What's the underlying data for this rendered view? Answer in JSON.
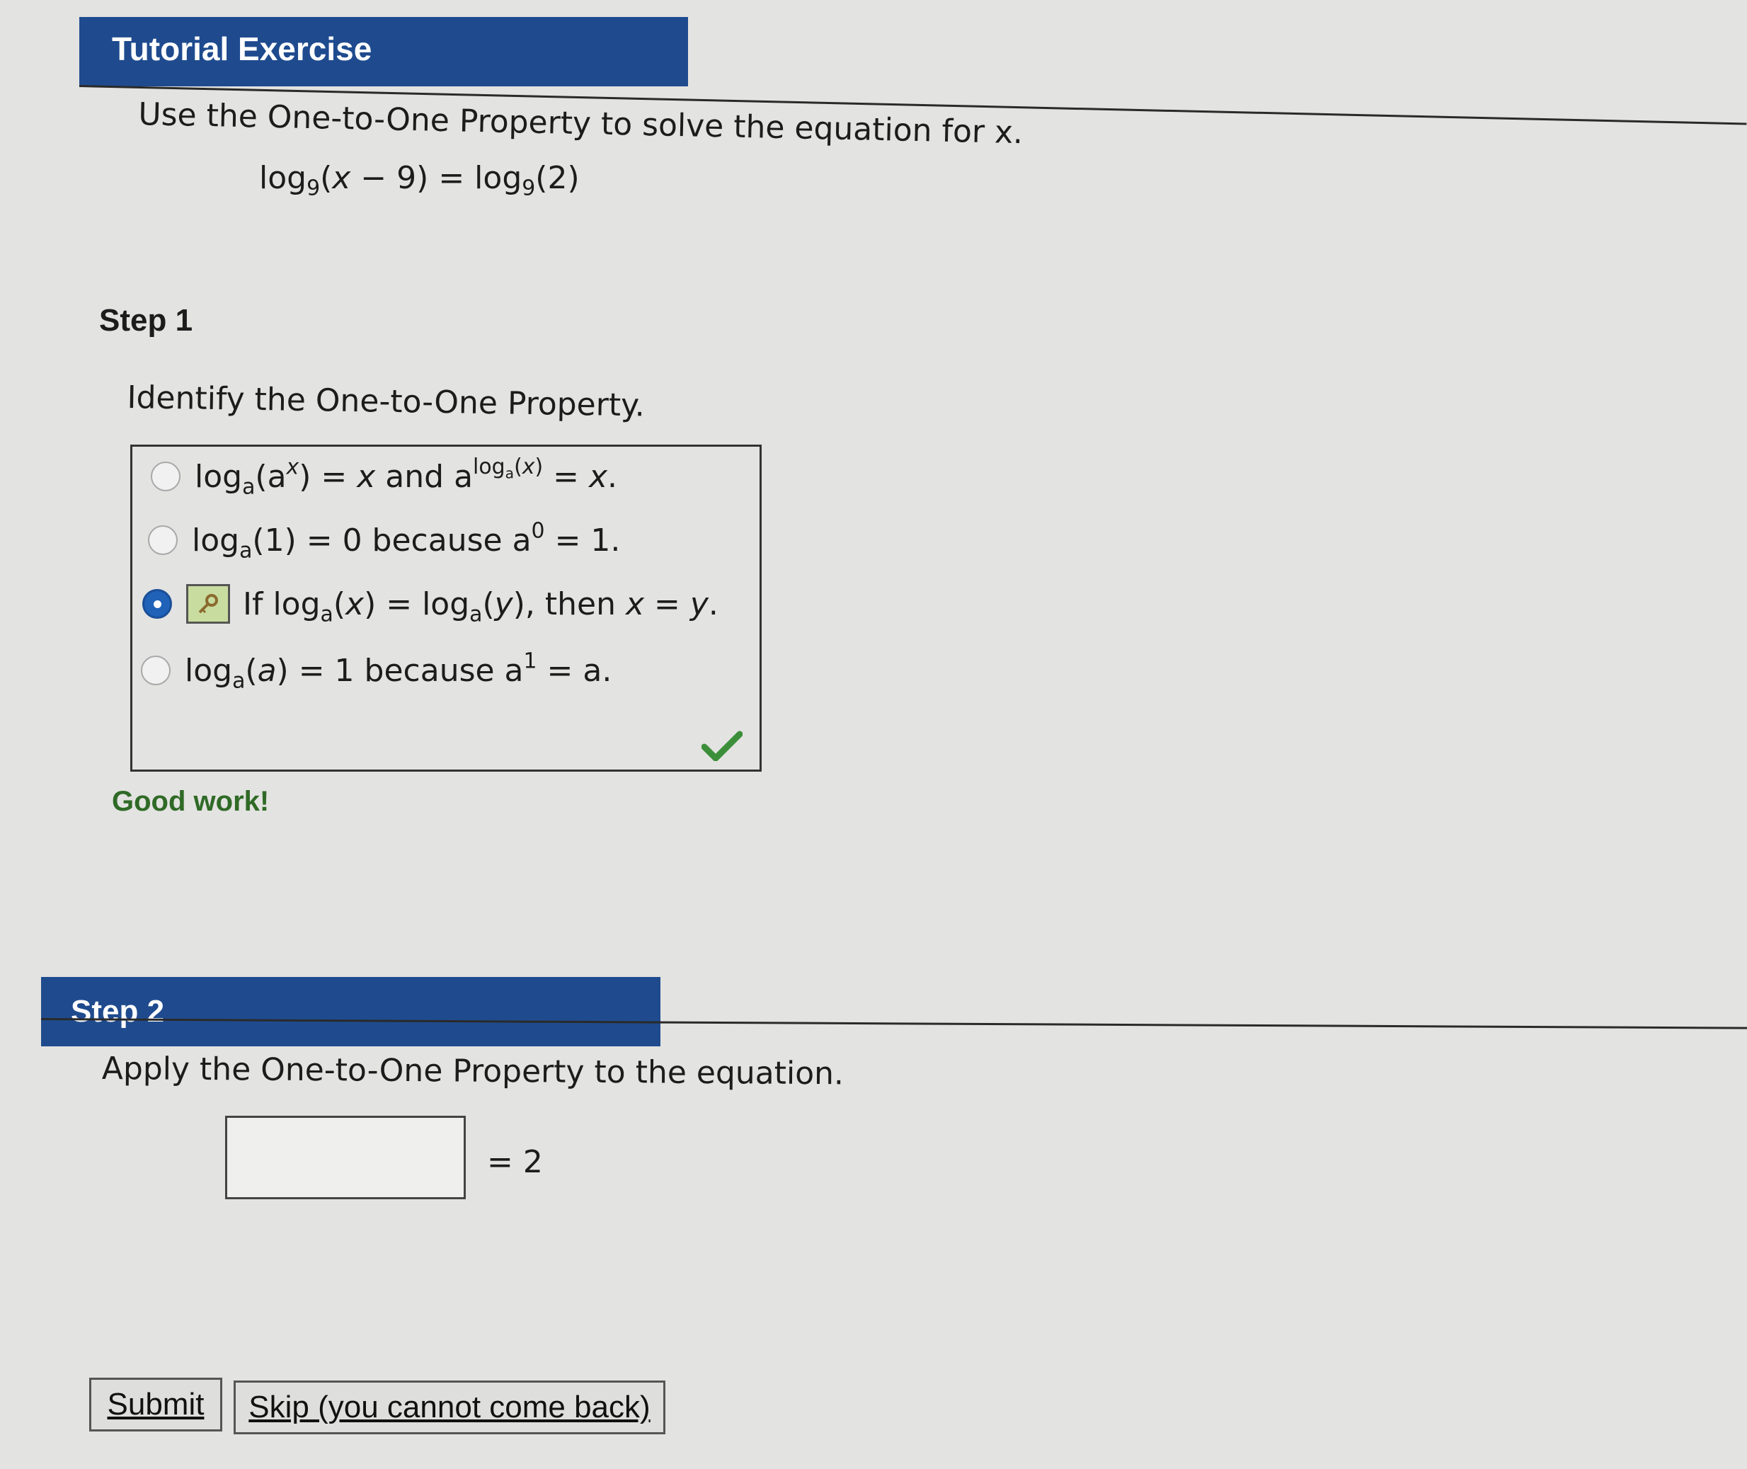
{
  "header": {
    "title": "Tutorial Exercise"
  },
  "problem": {
    "instruction": "Use the One-to-One Property to solve the equation for x.",
    "equation": "log9(x − 9) = log9(2)"
  },
  "step1": {
    "label": "Step 1",
    "prompt": "Identify the One-to-One Property.",
    "choices": [
      {
        "text": "loga(ax) = x and aloga(x) = x.",
        "selected": false
      },
      {
        "text": "loga(1) = 0 because a0 = 1.",
        "selected": false
      },
      {
        "text": "If loga(x) = loga(y), then x = y.",
        "selected": true
      },
      {
        "text": "loga(a) = 1 because a1 = a.",
        "selected": false
      }
    ],
    "feedback": "Good work!"
  },
  "step2": {
    "label": "Step 2",
    "prompt": "Apply the One-to-One Property to the equation.",
    "input_value": "",
    "equals_text": "= 2"
  },
  "buttons": {
    "submit_label": "Submit",
    "skip_label": "Skip (you cannot come back)"
  },
  "colors": {
    "header_bg": "#1f4b8e",
    "selected_radio": "#1f62b8",
    "feedback_text": "#2f6a26",
    "checkmark": "#3c8f3a",
    "key_icon_bg": "#c9dc9f"
  },
  "icons": [
    "check-icon",
    "key-icon"
  ]
}
